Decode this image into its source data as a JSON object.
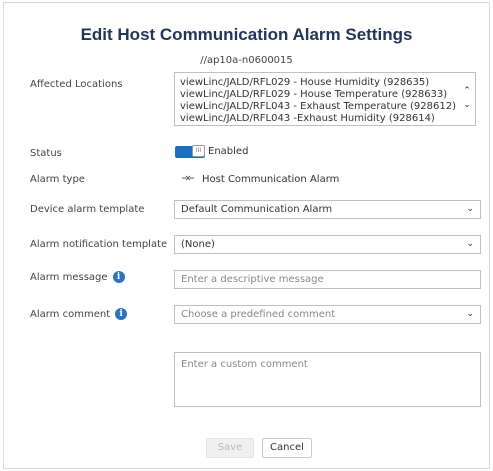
{
  "dialog": {
    "title": "Edit Host Communication Alarm Settings",
    "subtitle": "//ap10a-n0600015"
  },
  "labels": {
    "affected_locations": "Affected Locations",
    "status": "Status",
    "alarm_type": "Alarm type",
    "device_alarm_template": "Device alarm template",
    "alarm_notification_template": "Alarm notification template",
    "alarm_message": "Alarm message",
    "alarm_comment": "Alarm comment"
  },
  "locations": [
    "viewLinc/JALD/RFL029 - House Humidity (928635)",
    "viewLinc/JALD/RFL029 - House Temperature (928633)",
    "viewLinc/JALD/RFL043 - Exhaust Temperature (928612)",
    "viewLinc/JALD/RFL043 -Exhaust Humidity (928614)"
  ],
  "status": {
    "enabled": true,
    "label": "Enabled",
    "knob_text": "III"
  },
  "alarm_type": {
    "icon": "disconnect-icon",
    "value": "Host Communication Alarm"
  },
  "device_alarm_template": {
    "value": "Default Communication Alarm"
  },
  "alarm_notification_template": {
    "value": "(None)"
  },
  "alarm_message": {
    "placeholder": "Enter a descriptive message"
  },
  "alarm_comment": {
    "placeholder": "Choose a predefined comment"
  },
  "custom_comment": {
    "placeholder": "Enter a custom comment"
  },
  "buttons": {
    "save": "Save",
    "cancel": "Cancel"
  },
  "colors": {
    "title": "#23345c",
    "accent": "#1a6fc4",
    "info": "#2a74c7"
  }
}
